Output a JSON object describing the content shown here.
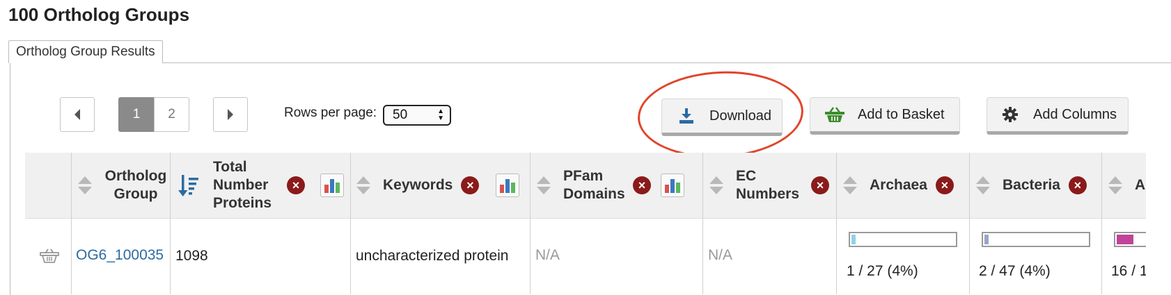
{
  "page": {
    "title": "100 Ortholog Groups"
  },
  "tabs": [
    {
      "label": "Ortholog Group Results"
    }
  ],
  "pagination": {
    "pages": [
      "1",
      "2"
    ],
    "current": "1",
    "rows_per_page_label": "Rows per page:",
    "rows_per_page_value": "50"
  },
  "actions": {
    "download_label": "Download",
    "add_to_basket_label": "Add to Basket",
    "add_columns_label": "Add Columns"
  },
  "colors": {
    "remove_icon": "#8b1a1a",
    "link": "#2b6ba3",
    "callout": "#e0452a",
    "archaea_fill": "#8fd3e8",
    "bacteria_fill": "#9aa6c8",
    "third_fill": "#c0449a"
  },
  "table": {
    "columns": [
      {
        "label": "Ortholog Group"
      },
      {
        "label": "Total Number Proteins"
      },
      {
        "label": "Keywords"
      },
      {
        "label": "PFam Domains"
      },
      {
        "label": "EC Numbers"
      },
      {
        "label": "Archaea"
      },
      {
        "label": "Bacteria"
      },
      {
        "label": "A"
      }
    ],
    "rows": [
      {
        "group_id": "OG6_100035",
        "total_proteins": "1098",
        "keywords": "uncharacterized protein",
        "pfam": "N/A",
        "ec": "N/A",
        "archaea": {
          "text": "1 / 27 (4%)",
          "fraction": 0.04
        },
        "bacteria": {
          "text": "2 / 47 (4%)",
          "fraction": 0.04
        },
        "third": {
          "text": "16 / 1",
          "fraction": 0.16
        }
      }
    ]
  }
}
